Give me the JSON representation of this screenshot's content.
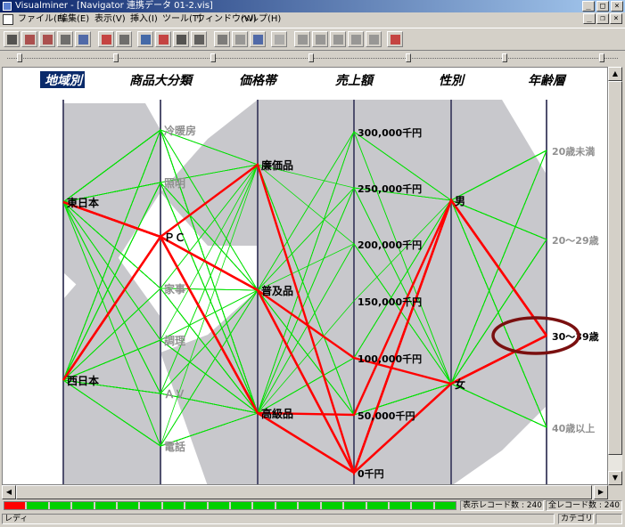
{
  "window": {
    "title": "Visualminer - [Navigator 連携データ 01-2.vis]",
    "min": "_",
    "max": "□",
    "close": "×"
  },
  "menu": [
    "ファイル(F)",
    "編集(E)",
    "表示(V)",
    "挿入(I)",
    "ツール(T)",
    "ウィンドウ(W)",
    "ヘルプ(H)"
  ],
  "mdi": {
    "min": "_",
    "restore": "❐",
    "close": "×"
  },
  "axes": [
    {
      "label": "地域別",
      "selected": true,
      "values": [
        "東日本",
        "西日本"
      ]
    },
    {
      "label": "商品大分類",
      "selected": false,
      "values": [
        "冷暖房",
        "照明",
        "ＰＣ",
        "家事",
        "調理",
        "ＡＶ",
        "電話"
      ]
    },
    {
      "label": "価格帯",
      "selected": false,
      "values": [
        "廉価品",
        "普及品",
        "高級品"
      ]
    },
    {
      "label": "売上額",
      "selected": false,
      "values": [
        "300,000千円",
        "250,000千円",
        "200,000千円",
        "150,000千円",
        "100,000千円",
        "50,000千円",
        "0千円"
      ]
    },
    {
      "label": "性別",
      "selected": false,
      "values": [
        "男",
        "女"
      ]
    },
    {
      "label": "年齢層",
      "selected": false,
      "values": [
        "20歳未満",
        "20～29歳",
        "30～39歳",
        "40歳以上"
      ]
    }
  ],
  "highlight": {
    "axis": "年齢層",
    "value": "30～39歳"
  },
  "status": {
    "progress_fraction": 0.05,
    "shown_records": "表示レコード数 : 240",
    "total_records": "全レコード数 : 240",
    "ready": "レディ",
    "mode": "カテゴリ"
  },
  "colors": {
    "selected_line": "#ff0000",
    "other_line": "#00e000",
    "band": "#c8c8cc",
    "axis": "#50506e",
    "highlight_ring": "#7a1010"
  },
  "icons": [
    "open-icon",
    "save-icon",
    "save-as-icon",
    "print-icon",
    "report-icon",
    "bar-chart-icon",
    "table-icon",
    "parallel-chart-icon",
    "heatmap-icon",
    "grid-icon",
    "zoom-in-icon",
    "zoom-out-icon",
    "pointer-icon",
    "mark-icon",
    "filter-icon",
    "copy-icon",
    "paint-icon",
    "edit-icon",
    "export-icon",
    "trash-icon",
    "help-icon"
  ]
}
